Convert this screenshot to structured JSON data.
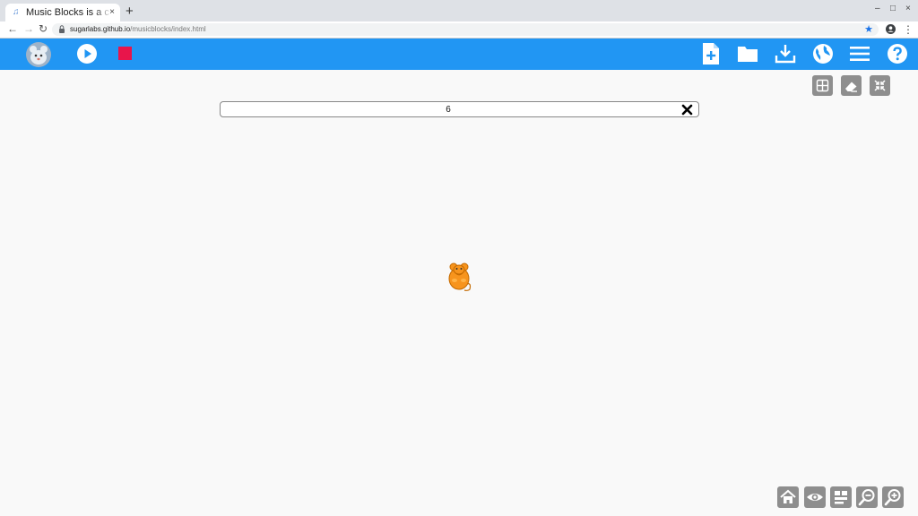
{
  "browser": {
    "tab_title": "Music Blocks is a c",
    "tab_close": "×",
    "new_tab": "+",
    "window_minimize": "–",
    "window_maximize": "□",
    "window_close": "×",
    "url_host": "sugarlabs.github.io",
    "url_path": "/musicblocks/index.html"
  },
  "appbar": {
    "color": "#2196f3",
    "stop_color": "#e53935",
    "left_buttons": [
      "mouse-logo-icon",
      "play-icon",
      "stop-icon"
    ],
    "right_buttons": [
      "new-file-icon",
      "open-folder-icon",
      "save-download-icon",
      "language-globe-icon",
      "menu-icon",
      "help-icon"
    ]
  },
  "canvas": {
    "search": {
      "value": "6",
      "placeholder": ""
    },
    "top_right_tools": [
      "grid-icon",
      "eraser-icon",
      "collapse-icon"
    ],
    "bottom_right_tools": [
      "home-icon",
      "eye-icon",
      "block-collapse-icon",
      "zoom-out-icon",
      "zoom-in-icon"
    ],
    "mouse_color": "#f7941d"
  }
}
